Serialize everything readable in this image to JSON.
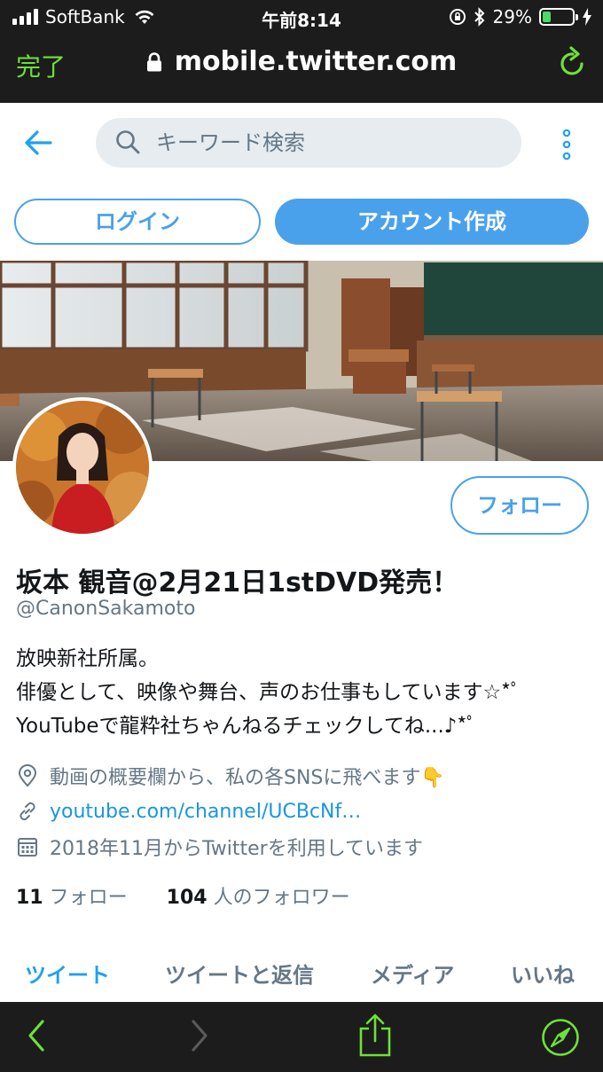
{
  "status_bar": {
    "carrier": "SoftBank",
    "time": "午前8:14",
    "battery_percent": "29%",
    "battery_level": 0.29,
    "signal_bars": 4
  },
  "safari": {
    "done_label": "完了",
    "url": "mobile.twitter.com"
  },
  "header": {
    "search_placeholder": "キーワード検索"
  },
  "auth": {
    "login_label": "ログイン",
    "signup_label": "アカウント作成"
  },
  "profile": {
    "follow_label": "フォロー",
    "display_name": "坂本 観音@2月21日1stDVD発売！",
    "handle": "@CanonSakamoto",
    "bio_lines": [
      "放映新社所属。",
      "俳優として、映像や舞台、声のお仕事もしています☆*ﾟ",
      "YouTubeで龍粋社ちゃんねるチェックしてね...♪*ﾟ"
    ],
    "location": "動画の概要欄から、私の各SNSに飛べます👇",
    "website": "youtube.com/channel/UCBcNf…",
    "joined": "2018年11月からTwitterを利用しています",
    "following_count": "11",
    "following_label": "フォロー",
    "followers_count": "104",
    "followers_label": "人のフォロワー"
  },
  "tabs": [
    {
      "label": "ツイート",
      "active": true
    },
    {
      "label": "ツイートと返信",
      "active": false
    },
    {
      "label": "メディア",
      "active": false
    },
    {
      "label": "いいね",
      "active": false
    }
  ],
  "colors": {
    "accent": "#1da1f2",
    "safari_green": "#6fe03a",
    "chrome_dark": "#1c1c1c"
  },
  "icons": {
    "back": "back-arrow-icon",
    "search": "search-icon",
    "more": "more-vertical-icon",
    "location": "location-pin-icon",
    "link": "link-icon",
    "calendar": "calendar-icon",
    "share": "share-icon",
    "compass": "compass-icon"
  }
}
